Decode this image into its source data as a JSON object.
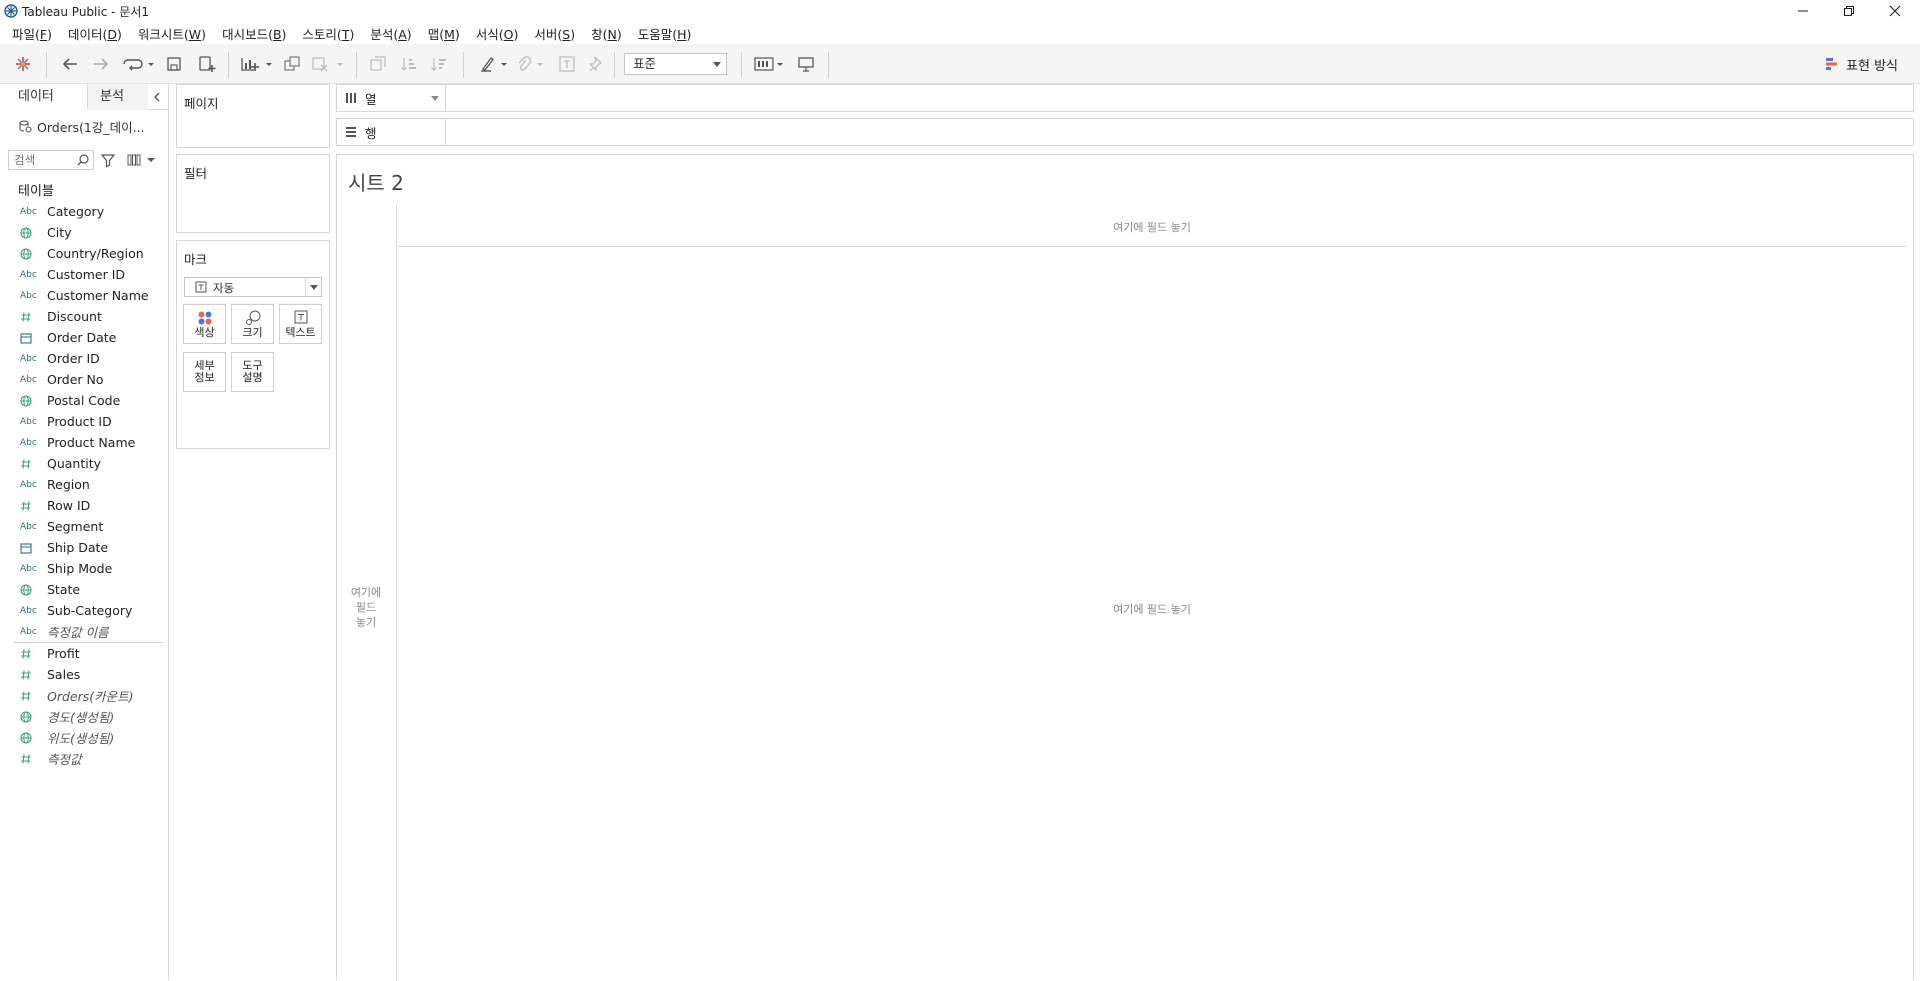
{
  "window": {
    "title": "Tableau Public - 문서1"
  },
  "menu": {
    "items": [
      {
        "label": "파일(",
        "key": "F",
        "end": ")"
      },
      {
        "label": "데이터(",
        "key": "D",
        "end": ")"
      },
      {
        "label": "워크시트(",
        "key": "W",
        "end": ")"
      },
      {
        "label": "대시보드(",
        "key": "B",
        "end": ")"
      },
      {
        "label": "스토리(",
        "key": "T",
        "end": ")"
      },
      {
        "label": "분석(",
        "key": "A",
        "end": ")"
      },
      {
        "label": "맵(",
        "key": "M",
        "end": ")"
      },
      {
        "label": "서식(",
        "key": "O",
        "end": ")"
      },
      {
        "label": "서버(",
        "key": "S",
        "end": ")"
      },
      {
        "label": "창(",
        "key": "N",
        "end": ")"
      },
      {
        "label": "도움말(",
        "key": "H",
        "end": ")"
      }
    ]
  },
  "toolbar": {
    "fit_value": "표준",
    "show_me_label": "표현 방식"
  },
  "data_pane": {
    "tab_data": "데이터",
    "tab_analysis": "분석",
    "datasource": "Orders(1강_데이...",
    "search_placeholder": "검색",
    "tables_heading": "테이블",
    "abc_label": "Abc",
    "dimensions": [
      {
        "name": "Category",
        "type": "abc"
      },
      {
        "name": "City",
        "type": "geo"
      },
      {
        "name": "Country/Region",
        "type": "geo"
      },
      {
        "name": "Customer ID",
        "type": "abc"
      },
      {
        "name": "Customer Name",
        "type": "abc"
      },
      {
        "name": "Discount",
        "type": "num"
      },
      {
        "name": "Order Date",
        "type": "date"
      },
      {
        "name": "Order ID",
        "type": "abc"
      },
      {
        "name": "Order No",
        "type": "abc"
      },
      {
        "name": "Postal Code",
        "type": "geo"
      },
      {
        "name": "Product ID",
        "type": "abc"
      },
      {
        "name": "Product Name",
        "type": "abc"
      },
      {
        "name": "Quantity",
        "type": "num"
      },
      {
        "name": "Region",
        "type": "abc"
      },
      {
        "name": "Row ID",
        "type": "num"
      },
      {
        "name": "Segment",
        "type": "abc"
      },
      {
        "name": "Ship Date",
        "type": "date"
      },
      {
        "name": "Ship Mode",
        "type": "abc"
      },
      {
        "name": "State",
        "type": "geo"
      },
      {
        "name": "Sub-Category",
        "type": "abc"
      },
      {
        "name": "측정값 이름",
        "type": "abc",
        "italic": true
      }
    ],
    "measures": [
      {
        "name": "Profit",
        "type": "num"
      },
      {
        "name": "Sales",
        "type": "num"
      },
      {
        "name": "Orders(카운트)",
        "type": "num",
        "italic": true
      },
      {
        "name": "경도(생성됨)",
        "type": "geo",
        "italic": true
      },
      {
        "name": "위도(생성됨)",
        "type": "geo",
        "italic": true
      },
      {
        "name": "측정값",
        "type": "num",
        "italic": true
      }
    ]
  },
  "cards": {
    "pages": "페이지",
    "filters": "필터",
    "marks": "마크",
    "mark_type": "자동",
    "color": "색상",
    "size": "크기",
    "text": "텍스트",
    "detail_line1": "세부",
    "detail_line2": "정보",
    "tooltip_line1": "도구",
    "tooltip_line2": "설명"
  },
  "shelves": {
    "columns": "열",
    "rows": "행"
  },
  "canvas": {
    "sheet_title": "시트 2",
    "drop_columns": "여기에 필드 놓기",
    "drop_center": "여기에 필드 놓기",
    "drop_rows_1": "여기에",
    "drop_rows_2": "필드",
    "drop_rows_3": "놓기"
  },
  "colors": {
    "abc_icon": "#2b6f90",
    "num_icon": "#3aa47e",
    "geo_icon": "#3aa47e",
    "date_icon": "#2b6f90",
    "accent_red": "#e8644a",
    "accent_blue": "#4b7bd6"
  }
}
